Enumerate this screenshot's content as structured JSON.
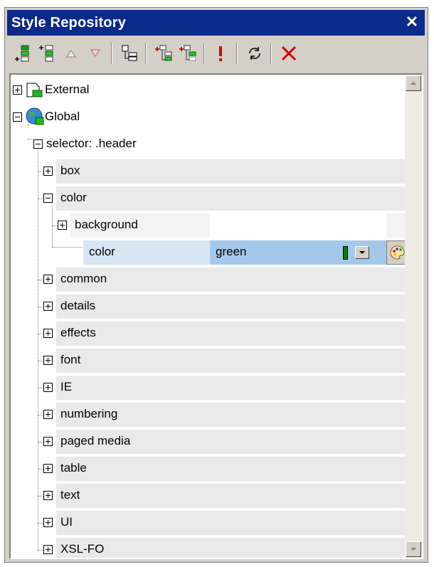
{
  "window": {
    "title": "Style Repository",
    "close_glyph": "✕"
  },
  "toolbar": {
    "buttons": [
      {
        "icon": "add-item-icon"
      },
      {
        "icon": "insert-item-icon"
      },
      {
        "icon": "move-up-icon"
      },
      {
        "icon": "move-down-icon"
      },
      {
        "icon": "expand-all-icon"
      },
      {
        "icon": "add-child-icon"
      },
      {
        "icon": "insert-child-icon"
      },
      {
        "icon": "important-icon"
      },
      {
        "icon": "reload-icon"
      },
      {
        "icon": "delete-icon"
      }
    ]
  },
  "tree": {
    "external": "External",
    "global": "Global",
    "selector": "selector: .header",
    "groups": [
      "box",
      "color",
      "common",
      "details",
      "effects",
      "font",
      "IE",
      "numbering",
      "paged media",
      "table",
      "text",
      "UI",
      "XSL-FO"
    ],
    "color_children": {
      "background": "background",
      "color_label": "color",
      "color_value": "green",
      "color_swatch": "#008000"
    }
  }
}
